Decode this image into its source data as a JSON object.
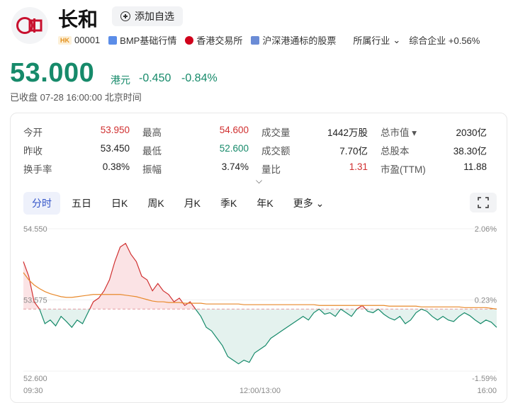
{
  "header": {
    "name": "长和",
    "add_watchlist": "添加自选",
    "market_badge": "HK",
    "code": "00001",
    "bmp_link": "BMP基础行情",
    "exchange": "香港交易所",
    "connect": "沪深港通标的股票",
    "industry_label": "所属行业",
    "industry_value": "综合企业 +0.56%"
  },
  "quote": {
    "price": "53.000",
    "unit": "港元",
    "change": "-0.450",
    "change_pct": "-0.84%",
    "status": "已收盘 07-28 16:00:00 北京时间"
  },
  "stats": [
    [
      {
        "label": "今开",
        "value": "53.950",
        "tone": "up"
      },
      {
        "label": "最高",
        "value": "54.600",
        "tone": "up"
      },
      {
        "label": "成交量",
        "value": "1442万股",
        "tone": ""
      },
      {
        "label": "总市值 ▾",
        "value": "2030亿",
        "tone": ""
      }
    ],
    [
      {
        "label": "昨收",
        "value": "53.450",
        "tone": ""
      },
      {
        "label": "最低",
        "value": "52.600",
        "tone": "down"
      },
      {
        "label": "成交额",
        "value": "7.70亿",
        "tone": ""
      },
      {
        "label": "总股本",
        "value": "38.30亿",
        "tone": ""
      }
    ],
    [
      {
        "label": "换手率",
        "value": "0.38%",
        "tone": ""
      },
      {
        "label": "振幅",
        "value": "3.74%",
        "tone": ""
      },
      {
        "label": "量比",
        "value": "1.31",
        "tone": "up"
      },
      {
        "label": "市盈(TTM)",
        "value": "11.88",
        "tone": ""
      }
    ]
  ],
  "tabs": [
    "分时",
    "五日",
    "日K",
    "周K",
    "月K",
    "季K",
    "年K",
    "更多"
  ],
  "chart_data": {
    "type": "line",
    "y_left_ticks": [
      "54.550",
      "53.575",
      "52.600"
    ],
    "y_right_ticks": [
      "2.06%",
      "0.23%",
      "-1.59%"
    ],
    "x_ticks": [
      "09:30",
      "12:00/13:00",
      "16:00"
    ],
    "ylim": [
      52.6,
      54.55
    ],
    "prev_close": 53.45,
    "series": [
      {
        "values": [
          54.1,
          53.9,
          53.55,
          53.45,
          53.25,
          53.3,
          53.22,
          53.35,
          53.28,
          53.2,
          53.3,
          53.25,
          53.4,
          53.55,
          53.6,
          53.7,
          53.85,
          54.1,
          54.3,
          54.35,
          54.2,
          54.1,
          53.9,
          53.85,
          53.7,
          53.8,
          53.7,
          53.65,
          53.55,
          53.6,
          53.5,
          53.55,
          53.45,
          53.35,
          53.2,
          53.15,
          53.05,
          52.95,
          52.8,
          52.75,
          52.7,
          52.75,
          52.72,
          52.85,
          52.9,
          52.95,
          53.05,
          53.1,
          53.15,
          53.2,
          53.25,
          53.3,
          53.35,
          53.3,
          53.4,
          53.45,
          53.38,
          53.4,
          53.35,
          53.45,
          53.4,
          53.35,
          53.45,
          53.5,
          53.42,
          53.4,
          53.45,
          53.38,
          53.33,
          53.3,
          53.35,
          53.25,
          53.3,
          53.4,
          53.45,
          53.42,
          53.35,
          53.3,
          53.35,
          53.3,
          53.28,
          53.35,
          53.4,
          53.36,
          53.3,
          53.25,
          53.3,
          53.27,
          53.2
        ]
      },
      {
        "values": [
          53.95,
          53.85,
          53.78,
          53.73,
          53.69,
          53.66,
          53.64,
          53.62,
          53.61,
          53.61,
          53.62,
          53.63,
          53.64,
          53.65,
          53.65,
          53.65,
          53.65,
          53.65,
          53.65,
          53.64,
          53.63,
          53.62,
          53.6,
          53.58,
          53.56,
          53.55,
          53.55,
          53.54,
          53.54,
          53.54,
          53.53,
          53.53,
          53.53,
          53.53,
          53.52,
          53.52,
          53.52,
          53.52,
          53.52,
          53.52,
          53.52,
          53.51,
          53.51,
          53.51,
          53.51,
          53.51,
          53.51,
          53.51,
          53.51,
          53.51,
          53.51,
          53.51,
          53.51,
          53.51,
          53.51,
          53.5,
          53.5,
          53.5,
          53.5,
          53.5,
          53.5,
          53.5,
          53.5,
          53.5,
          53.5,
          53.5,
          53.5,
          53.5,
          53.49,
          53.49,
          53.49,
          53.49,
          53.49,
          53.49,
          53.48,
          53.48,
          53.48,
          53.48,
          53.48,
          53.48,
          53.48,
          53.48,
          53.47,
          53.47,
          53.47,
          53.47,
          53.47,
          53.46,
          53.45
        ]
      }
    ],
    "colors": {
      "price_up": "#d03030",
      "price_down": "#168a6a",
      "avg": "#e8892b",
      "prev_close": "#e69aa0"
    }
  }
}
